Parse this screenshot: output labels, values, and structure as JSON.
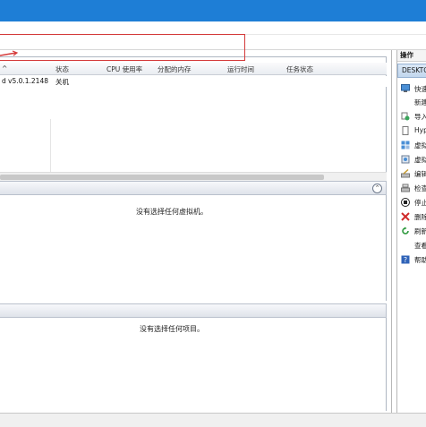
{
  "vm_list": {
    "sort_indicator": "^",
    "columns": [
      "状态",
      "CPU 使用率",
      "分配的内存",
      "运行时间",
      "任务状态"
    ],
    "rows": [
      {
        "name_fragment": "d",
        "version": "v5.0.1.2148",
        "state": "关机"
      }
    ]
  },
  "snapshots": {
    "empty_message": "没有选择任何虚拟机。",
    "collapse_glyph": "⌃"
  },
  "details": {
    "empty_message": "没有选择任何项目。"
  },
  "actions_pane": {
    "title": "操作",
    "host": "DESKTO",
    "items": [
      {
        "icon": "monitor-icon",
        "label": "快速"
      },
      {
        "icon": "new-icon",
        "label": "新建"
      },
      {
        "icon": "import-icon",
        "label": "导入"
      },
      {
        "icon": "page-icon",
        "label": "Hyp"
      },
      {
        "icon": "switch-manager-icon",
        "label": "虚拟"
      },
      {
        "icon": "san-manager-icon",
        "label": "虚拟"
      },
      {
        "icon": "edit-disk-icon",
        "label": "编辑"
      },
      {
        "icon": "inspect-disk-icon",
        "label": "检查"
      },
      {
        "icon": "stop-icon",
        "label": "停止"
      },
      {
        "icon": "delete-icon",
        "label": "删除"
      },
      {
        "icon": "refresh-icon",
        "label": "刷新"
      },
      {
        "icon": "view-icon",
        "label": "查看"
      },
      {
        "icon": "help-icon",
        "label": "帮助"
      }
    ]
  },
  "colors": {
    "titlebar": "#1e7ed6",
    "annotation_red": "#d43a3a",
    "selection_blue": "#c2d7ee"
  }
}
